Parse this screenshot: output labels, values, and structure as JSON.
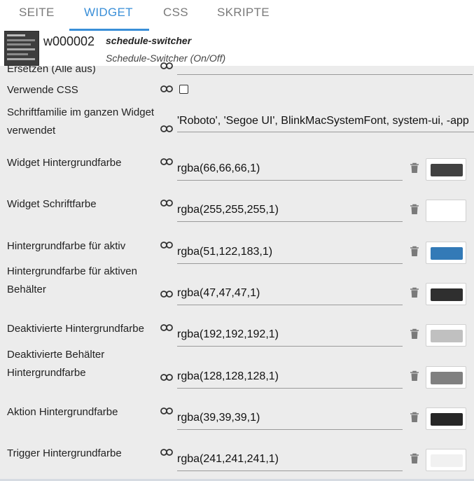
{
  "tabs": [
    "SEITE",
    "WIDGET",
    "CSS",
    "SKRIPTE"
  ],
  "widget": {
    "id": "w000002",
    "name": "schedule-switcher",
    "subtitle": "Schedule-Switcher (On/Off)"
  },
  "rows": {
    "replace": {
      "label": "Ersetzen (Alle aus)"
    },
    "use_css": {
      "label": "Verwende CSS",
      "checked": false
    },
    "font_family": {
      "label_line1": "Schriftfamilie im ganzen Widget",
      "label_line2": "verwendet",
      "value": "'Roboto', 'Segoe UI', BlinkMacSystemFont, system-ui, -app"
    },
    "colors": [
      {
        "label_line1": "Widget Hintergrundfarbe",
        "label_line2": "",
        "value": "rgba(66,66,66,1)",
        "color": "#424242"
      },
      {
        "label_line1": "Widget Schriftfarbe",
        "label_line2": "",
        "value": "rgba(255,255,255,1)",
        "color": "#ffffff"
      },
      {
        "label_line1": "Hintergrundfarbe für aktiv",
        "label_line2": "",
        "value": "rgba(51,122,183,1)",
        "color": "#337ab7"
      },
      {
        "label_line1": "Hintergrundfarbe für aktiven",
        "label_line2": "Behälter",
        "value": "rgba(47,47,47,1)",
        "color": "#2f2f2f"
      },
      {
        "label_line1": "Deaktivierte Hintergrundfarbe",
        "label_line2": "",
        "value": "rgba(192,192,192,1)",
        "color": "#c0c0c0"
      },
      {
        "label_line1": "Deaktivierte Behälter",
        "label_line2": "Hintergrundfarbe",
        "value": "rgba(128,128,128,1)",
        "color": "#808080"
      },
      {
        "label_line1": "Aktion Hintergrundfarbe",
        "label_line2": "",
        "value": "rgba(39,39,39,1)",
        "color": "#272727"
      },
      {
        "label_line1": "Trigger Hintergrundfarbe",
        "label_line2": "",
        "value": "rgba(241,241,241,1)",
        "color": "#f1f1f1"
      }
    ]
  },
  "icons": {
    "link": "link-icon",
    "delete": "trash-icon"
  },
  "accent_color": "#3a8fd8"
}
